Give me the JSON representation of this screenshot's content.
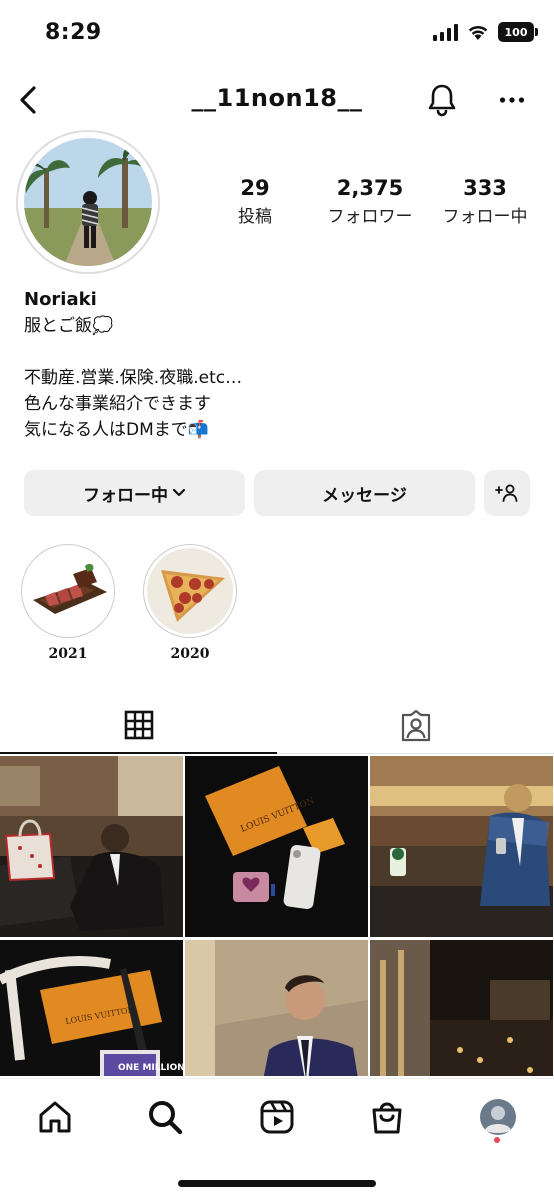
{
  "status": {
    "time": "8:29",
    "battery": "100"
  },
  "header": {
    "username": "__11non18__"
  },
  "profile": {
    "stats": [
      {
        "num": "29",
        "label": "投稿"
      },
      {
        "num": "2,375",
        "label": "フォロワー"
      },
      {
        "num": "333",
        "label": "フォロー中"
      }
    ],
    "name": "Noriaki",
    "bio_line1": "服とご飯💭",
    "bio_line2": "不動産.営業.保険.夜職.etc…",
    "bio_line3": "色んな事業紹介できます",
    "bio_line4": "気になる人はDMまで📬"
  },
  "buttons": {
    "follow": "フォロー中",
    "message": "メッセージ"
  },
  "highlights": [
    {
      "label": "2021"
    },
    {
      "label": "2020"
    }
  ],
  "tiles": [
    {
      "brand": ""
    },
    {
      "brand": "LOUIS VUITTON"
    },
    {
      "brand": ""
    },
    {
      "brand": "LOUIS VUITTON",
      "card": "ONE MILLION"
    },
    {
      "brand": ""
    },
    {
      "brand": ""
    }
  ],
  "colors": {
    "accent": "#ed4956",
    "button_bg": "#efefef",
    "text": "#111111"
  }
}
